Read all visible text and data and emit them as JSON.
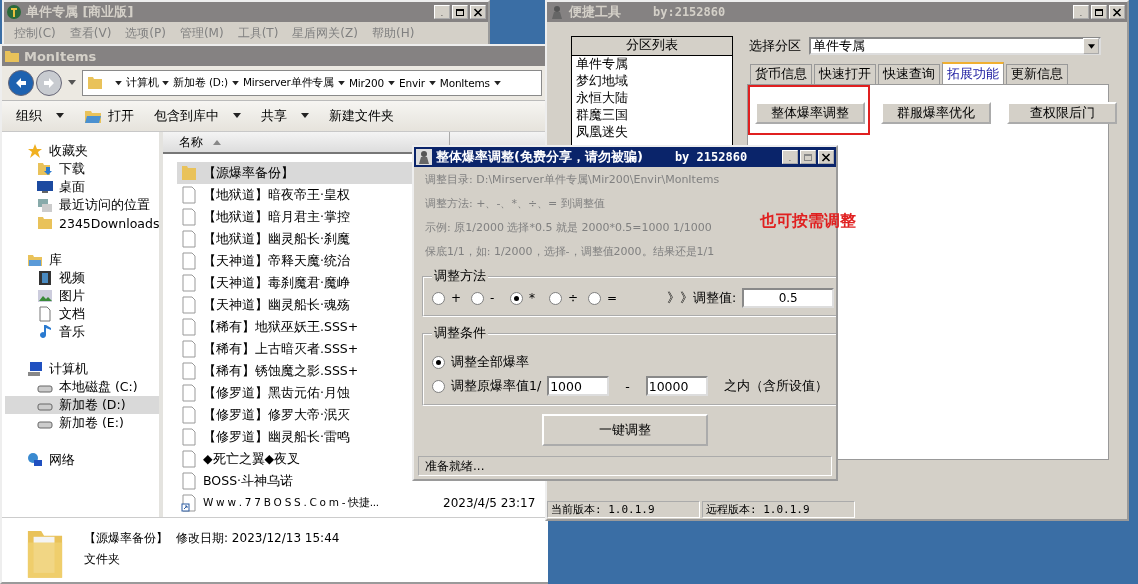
{
  "app_window": {
    "title": "单件专属 [商业版]",
    "menu": [
      "控制(C)",
      "查看(V)",
      "选项(P)",
      "管理(M)",
      "工具(T)",
      "星盾网关(Z)",
      "帮助(H)"
    ]
  },
  "explorer": {
    "title": "MonItems",
    "breadcrumb": [
      "计算机",
      "新加卷 (D:)",
      "Mirserver单件专属",
      "Mir200",
      "Envir",
      "MonItems"
    ],
    "toolbar": [
      {
        "label": "组织",
        "kind": "menu"
      },
      {
        "label": "打开",
        "kind": "open"
      },
      {
        "label": "包含到库中",
        "kind": "menu"
      },
      {
        "label": "共享",
        "kind": "menu"
      },
      {
        "label": "新建文件夹",
        "kind": "plain"
      }
    ],
    "nav": [
      {
        "label": "收藏夹",
        "kind": "star",
        "selected": false,
        "children": [
          {
            "label": "下载",
            "kind": "download",
            "selected": false
          },
          {
            "label": "桌面",
            "kind": "desktop",
            "selected": false
          },
          {
            "label": "最近访问的位置",
            "kind": "recent",
            "selected": false
          },
          {
            "label": "2345Downloads",
            "kind": "folder",
            "selected": false
          }
        ]
      },
      {
        "label": "库",
        "kind": "library",
        "selected": false,
        "children": [
          {
            "label": "视频",
            "kind": "video",
            "selected": false
          },
          {
            "label": "图片",
            "kind": "image",
            "selected": false
          },
          {
            "label": "文档",
            "kind": "document",
            "selected": false
          },
          {
            "label": "音乐",
            "kind": "music",
            "selected": false
          }
        ]
      },
      {
        "label": "计算机",
        "kind": "computer",
        "selected": false,
        "children": [
          {
            "label": "本地磁盘 (C:)",
            "kind": "drive",
            "selected": false
          },
          {
            "label": "新加卷 (D:)",
            "kind": "drive",
            "selected": true
          },
          {
            "label": "新加卷 (E:)",
            "kind": "drive",
            "selected": false
          }
        ]
      },
      {
        "label": "网络",
        "kind": "network",
        "selected": false
      }
    ],
    "columns": [
      "名称"
    ],
    "files": [
      {
        "name": "【源爆率备份】",
        "kind": "folder",
        "selected": true
      },
      {
        "name": "【地狱道】暗夜帝王·皇权",
        "kind": "file",
        "selected": false
      },
      {
        "name": "【地狱道】暗月君主·掌控",
        "kind": "file",
        "selected": false
      },
      {
        "name": "【地狱道】幽灵船长·刹魔",
        "kind": "file",
        "selected": false
      },
      {
        "name": "【天神道】帝释天魔·统治",
        "kind": "file",
        "selected": false
      },
      {
        "name": "【天神道】毒刹魔君·魔峥",
        "kind": "file",
        "selected": false
      },
      {
        "name": "【天神道】幽灵船长·魂殇",
        "kind": "file",
        "selected": false
      },
      {
        "name": "【稀有】地狱巫妖王.SSS+",
        "kind": "file",
        "selected": false
      },
      {
        "name": "【稀有】上古暗灭者.SSS+",
        "kind": "file",
        "selected": false
      },
      {
        "name": "【稀有】锈蚀魔之影.SSS+",
        "kind": "file",
        "selected": false
      },
      {
        "name": "【修罗道】黑齿元佑·月蚀",
        "kind": "file",
        "selected": false
      },
      {
        "name": "【修罗道】修罗大帝·泯灭",
        "kind": "file",
        "selected": false
      },
      {
        "name": "【修罗道】幽灵船长·雷鸣",
        "kind": "file",
        "selected": false
      },
      {
        "name": "◆死亡之翼◆夜叉",
        "kind": "file",
        "selected": false
      },
      {
        "name": "BOSS·斗神乌诺",
        "kind": "file",
        "selected": false
      },
      {
        "name": "W w w . 7 7 B O S S . C o m - 快捷...",
        "kind": "shortcut",
        "selected": false,
        "date": "2023/4/5 23:17"
      }
    ],
    "details": {
      "name": "【源爆率备份】",
      "modified": "修改日期: 2023/12/13 15:44",
      "type": "文件夹"
    }
  },
  "tool_window": {
    "title": "便捷工具",
    "by": "by:2152860",
    "list_header": "分区列表",
    "partitions": [
      "单件专属",
      "梦幻地域",
      "永恒大陆",
      "群魔三国",
      "凤凰迷失"
    ],
    "select_label": "选择分区",
    "select_value": "单件专属",
    "tabs": [
      {
        "label": "货币信息",
        "selected": false
      },
      {
        "label": "快速打开",
        "selected": false
      },
      {
        "label": "快速查询",
        "selected": false
      },
      {
        "label": "拓展功能",
        "selected": true
      },
      {
        "label": "更新信息",
        "selected": false
      }
    ],
    "buttons": [
      {
        "label": "整体爆率调整",
        "highlighted": true
      },
      {
        "label": "群服爆率优化",
        "highlighted": false
      },
      {
        "label": "查权限后门",
        "highlighted": false
      }
    ],
    "status": [
      "当前版本: 1.0.1.9",
      "远程版本: 1.0.1.9"
    ]
  },
  "dialog": {
    "title": "整体爆率调整(免费分享，请勿被骗)",
    "by": "by 2152860",
    "info": [
      "调整目录: D:\\Mirserver单件专属\\Mir200\\Envir\\MonItems",
      "调整方法: +、-、*、÷、=   到调整值",
      "示例: 原1/2000 选择*0.5 就是 2000*0.5=1000  1/1000",
      "保底1/1，如: 1/2000，选择-，调整值2000。结果还是1/1"
    ],
    "method": {
      "title": "调整方法",
      "options": [
        {
          "label": "+",
          "selected": false
        },
        {
          "label": "-",
          "selected": false
        },
        {
          "label": "*",
          "selected": true
        },
        {
          "label": "÷",
          "selected": false
        },
        {
          "label": "=",
          "selected": false
        }
      ],
      "value_label": "》》调整值:",
      "value": "0.5"
    },
    "condition": {
      "title": "调整条件",
      "all_label": "调整全部爆率",
      "all_selected": true,
      "range_label": "调整原爆率值1/",
      "range_selected": false,
      "from": "1000",
      "separator": "-",
      "to": "10000",
      "suffix": "之内（含所设值）"
    },
    "button": "一键调整",
    "status": "准备就绪..."
  },
  "annotation": "也可按需调整"
}
